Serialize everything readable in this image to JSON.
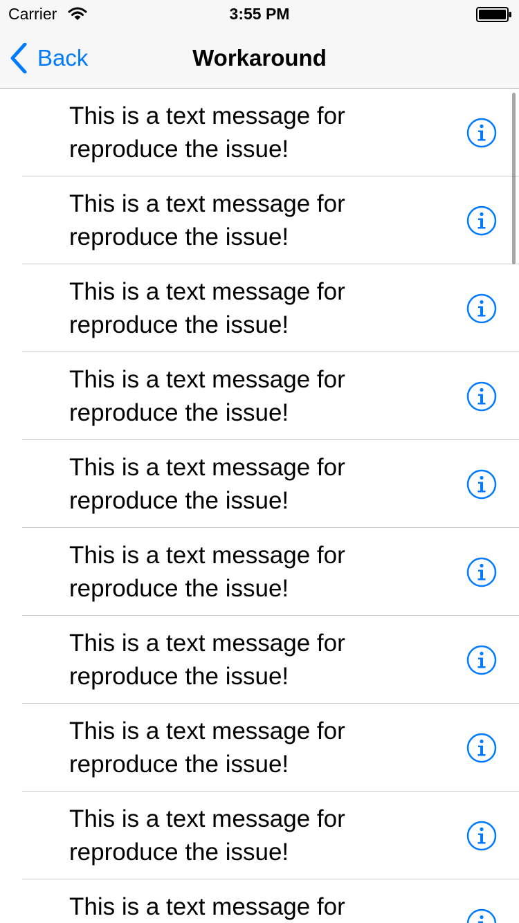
{
  "status_bar": {
    "carrier": "Carrier",
    "time": "3:55 PM",
    "wifi_icon": "wifi-icon",
    "battery_icon": "battery-icon"
  },
  "nav": {
    "back_label": "Back",
    "title": "Workaround"
  },
  "colors": {
    "tint": "#007aff",
    "separator": "#c8c7cc",
    "bar_background": "#f7f7f7"
  },
  "rows": [
    {
      "text": "This is a text message for reproduce the issue!",
      "accessory": "info-icon"
    },
    {
      "text": "This is a text message for reproduce the issue!",
      "accessory": "info-icon"
    },
    {
      "text": "This is a text message for reproduce the issue!",
      "accessory": "info-icon"
    },
    {
      "text": "This is a text message for reproduce the issue!",
      "accessory": "info-icon"
    },
    {
      "text": "This is a text message for reproduce the issue!",
      "accessory": "info-icon"
    },
    {
      "text": "This is a text message for reproduce the issue!",
      "accessory": "info-icon"
    },
    {
      "text": "This is a text message for reproduce the issue!",
      "accessory": "info-icon"
    },
    {
      "text": "This is a text message for reproduce the issue!",
      "accessory": "info-icon"
    },
    {
      "text": "This is a text message for reproduce the issue!",
      "accessory": "info-icon"
    },
    {
      "text": "This is a text message for reproduce the issue!",
      "accessory": "info-icon"
    }
  ]
}
